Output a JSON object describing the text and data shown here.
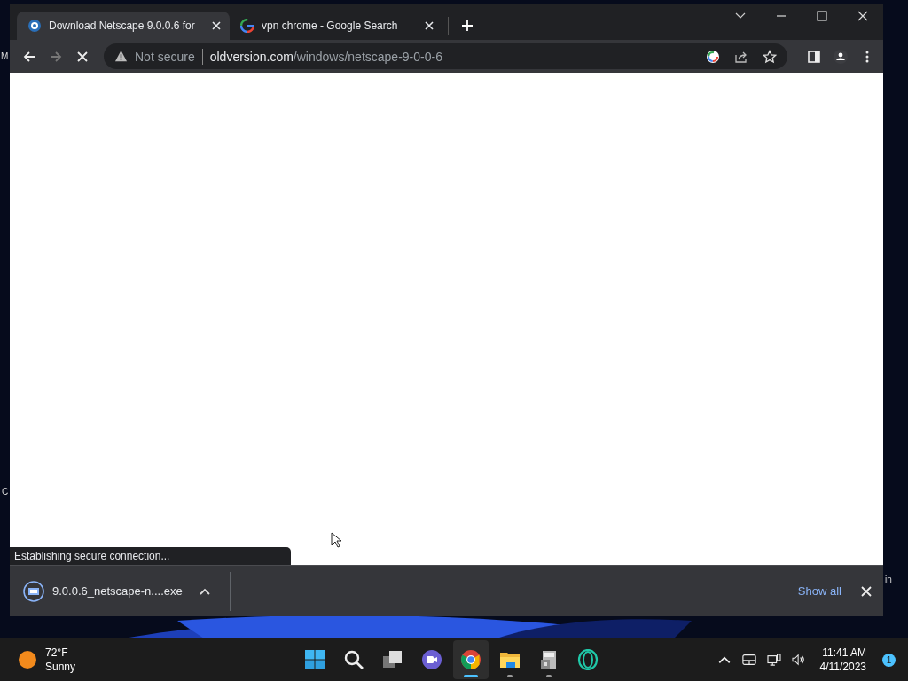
{
  "desktop_fragments": [
    "M",
    "C",
    "in"
  ],
  "tabs": [
    {
      "title": "Download Netscape 9.0.0.6 for",
      "kind": "site",
      "selected": true
    },
    {
      "title": "vpn chrome - Google Search",
      "kind": "google",
      "selected": false
    }
  ],
  "toolbar": {
    "back_disabled": false,
    "forward_disabled": true,
    "loading": true
  },
  "address": {
    "security": "Not secure",
    "domain": "oldversion.com",
    "path": "/windows/netscape-9-0-0-6"
  },
  "status_text": "Establishing secure connection...",
  "download": {
    "filename": "9.0.0.6_netscape-n....exe",
    "show_all": "Show all"
  },
  "weather": {
    "temperature": "72°F",
    "condition": "Sunny"
  },
  "taskbar_apps": [
    {
      "kind": "start",
      "running": false,
      "active": false
    },
    {
      "kind": "search",
      "running": false,
      "active": false
    },
    {
      "kind": "taskview",
      "running": false,
      "active": false
    },
    {
      "kind": "meet",
      "running": false,
      "active": false
    },
    {
      "kind": "chrome",
      "running": true,
      "active": true
    },
    {
      "kind": "explorer",
      "running": true,
      "active": false
    },
    {
      "kind": "installer",
      "running": true,
      "active": false
    },
    {
      "kind": "opera",
      "running": false,
      "active": false
    }
  ],
  "clock": {
    "time": "11:41 AM",
    "date": "4/11/2023"
  },
  "notification_count": "1"
}
